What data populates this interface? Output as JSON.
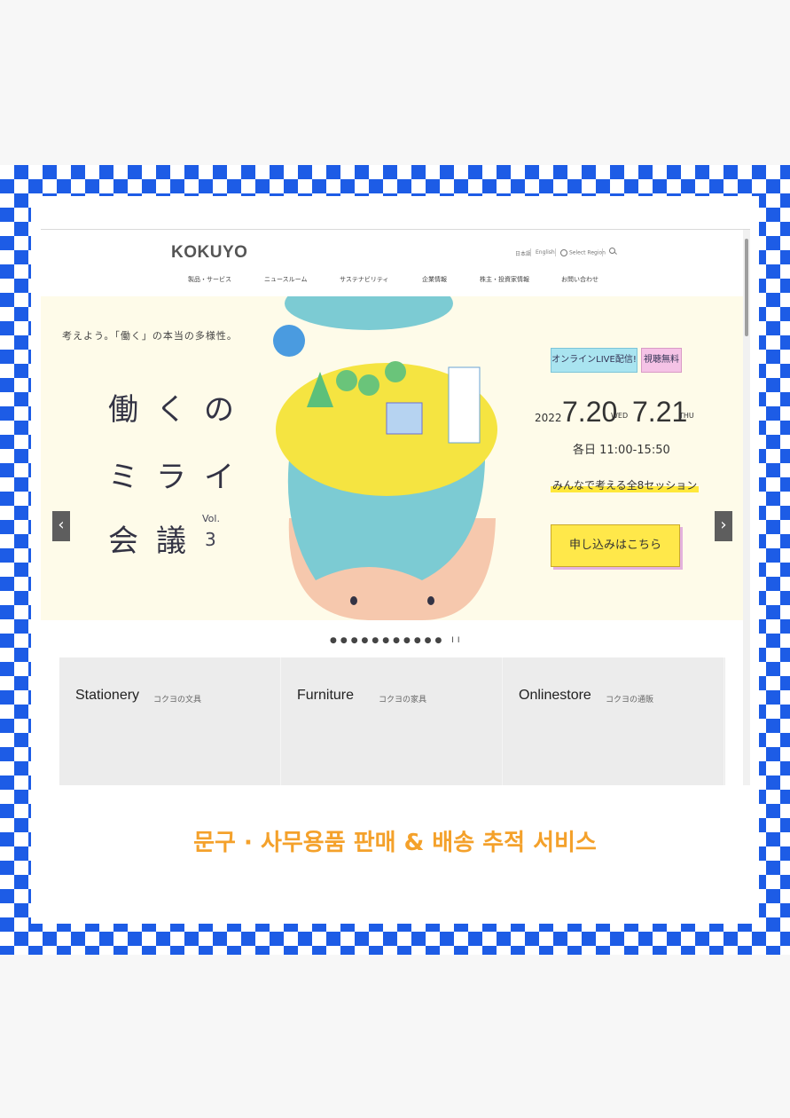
{
  "site": {
    "logo": "KOKUYO",
    "util": {
      "lang_ja": "日本語",
      "lang_en": "English",
      "region": "Select Region"
    },
    "nav": [
      "製品・サービス",
      "ニュースルーム",
      "サステナビリティ",
      "企業情報",
      "株主・投資家情報",
      "お問い合わせ"
    ]
  },
  "hero": {
    "tagline": "考えよう。「働く」の本当の多様性。",
    "title_lines": [
      "働くの",
      "ミライ",
      "会議"
    ],
    "vol_label": "Vol.",
    "vol_number": "3",
    "badge_live": "オンラインLIVE配信!",
    "badge_free": "視聴無料",
    "year": "2022",
    "date1": "7.20",
    "weekday1": "WED",
    "date2": "7.21",
    "weekday2": "THU",
    "time": "各日 11:00-15:50",
    "sessions": "みんなで考える全8セッション",
    "cta": "申し込みはこちら",
    "prev_arrow": "‹",
    "next_arrow": "›"
  },
  "carousel": {
    "dots": "●●●●●●●●●●●",
    "pause": "II"
  },
  "cards": [
    {
      "title": "Stationery",
      "subtitle": "コクヨの文具"
    },
    {
      "title": "Furniture",
      "subtitle": "コクヨの家具"
    },
    {
      "title": "Onlinestore",
      "subtitle": "コクヨの通販"
    }
  ],
  "caption": "문구 · 사무용품 판매 & 배송 추적 서비스",
  "colors": {
    "checker": "#1d5ce6",
    "caption": "#f4a12b",
    "hero_bg": "#fefbe9",
    "head_teal": "#7ccbd3"
  }
}
